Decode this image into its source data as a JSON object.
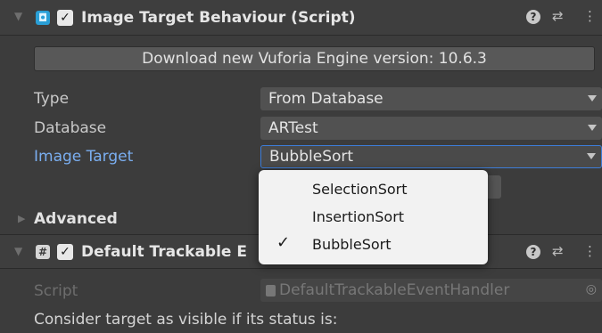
{
  "image_target_component": {
    "title": "Image Target Behaviour (Script)",
    "enabled_check": "✓",
    "download_button": "Download new Vuforia Engine version: 10.6.3",
    "fields": {
      "type_label": "Type",
      "type_value": "From Database",
      "database_label": "Database",
      "database_value": "ARTest",
      "image_target_label": "Image Target",
      "image_target_value": "BubbleSort"
    },
    "advanced_label": "Advanced"
  },
  "dropdown": {
    "options": [
      "SelectionSort",
      "InsertionSort",
      "BubbleSort"
    ],
    "selected": "BubbleSort",
    "check_glyph": "✓"
  },
  "trackable_component": {
    "title_visible": "Default Trackable E",
    "enabled_check": "✓",
    "script_label": "Script",
    "script_value": "DefaultTrackableEventHandler",
    "consider_text": "Consider target as visible if its status is:"
  },
  "icons": {
    "help": "?",
    "presets": "⇄",
    "more": "⋮",
    "hash": "#",
    "target_dot": "◎"
  },
  "colors": {
    "panel_bg": "#3c3c3c",
    "field_bg": "#515151",
    "highlight_label": "#7aaef0",
    "menu_bg": "#f2f2f2",
    "component_icon": "#2a9fd6"
  }
}
